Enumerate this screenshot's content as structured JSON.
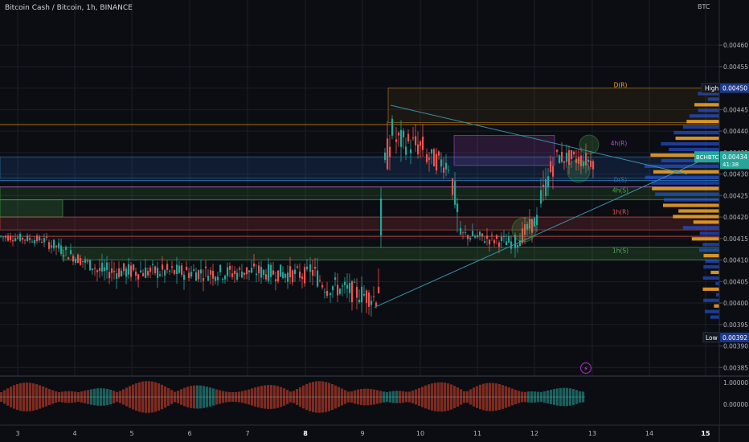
{
  "header": {
    "symbol_title": "Bitcoin Cash / Bitcoin, 1h, BINANCE",
    "currency": "BTC"
  },
  "colors": {
    "background": "#0b0d12",
    "up": "#26a69a",
    "down": "#ef5350",
    "grid": "#1a1e28",
    "trendline": "#3a8fa8",
    "text": "#b2b5be",
    "volume_profile_blue": "#2962ff",
    "volume_profile_orange": "#f7a928"
  },
  "chart_data": {
    "type": "candlestick",
    "title": "Bitcoin Cash / Bitcoin, 1h, BINANCE",
    "ylabel": "BTC",
    "ylim": [
      0.00383,
      0.00466
    ],
    "y_ticks": [
      "0.00460",
      "0.00455",
      "0.00450",
      "0.00445",
      "0.00440",
      "0.00435",
      "0.00430",
      "0.00425",
      "0.00420",
      "0.00415",
      "0.00410",
      "0.00405",
      "0.00400",
      "0.00395",
      "0.00390",
      "0.00385"
    ],
    "x_ticks": [
      "3",
      "4",
      "5",
      "6",
      "7",
      "8",
      "9",
      "10",
      "11",
      "12",
      "13",
      "14",
      "15"
    ],
    "x_tick_bold": [
      "8",
      "15"
    ],
    "level_labels": [
      {
        "text": "D(R)",
        "price": 0.0045,
        "color": "#f7a928"
      },
      {
        "text": "4h(R)",
        "price": 0.004365,
        "color": "#b04fd0"
      },
      {
        "text": "D(S)",
        "price": 0.00428,
        "color": "#2a6fd6"
      },
      {
        "text": "4h(S)",
        "price": 0.004255,
        "color": "#4caf50"
      },
      {
        "text": "1h(R)",
        "price": 0.004205,
        "color": "#ef5350"
      },
      {
        "text": "1h(S)",
        "price": 0.004115,
        "color": "#4caf50"
      }
    ],
    "price_labels": [
      {
        "text": "High",
        "value": "0.00450"
      },
      {
        "text": "BCHBTC",
        "value": "0.00434",
        "sub": "41:38"
      },
      {
        "text": "Low",
        "value": "0.00392"
      }
    ],
    "indicator": {
      "ylim_labels": [
        "1.00000",
        "0.00000"
      ]
    }
  }
}
